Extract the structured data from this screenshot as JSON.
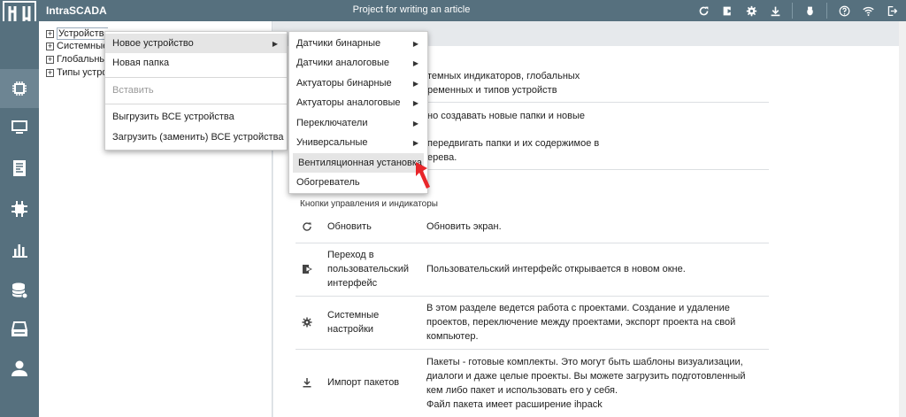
{
  "app": {
    "name": "IntraSCADA",
    "project": "Project for writing an article"
  },
  "topbar": {
    "icons": [
      "refresh-icon",
      "open-ui-icon",
      "gear-icon",
      "download-icon",
      "bug-icon",
      "help-icon",
      "wifi-icon",
      "logout-icon"
    ]
  },
  "sidebar": {
    "items": [
      "devices-icon",
      "monitor-icon",
      "document-icon",
      "network-icon",
      "chart-icon",
      "database-icon",
      "printer-icon",
      "user-icon"
    ]
  },
  "tree": {
    "items": [
      {
        "label": "Устройства"
      },
      {
        "label": "Системные"
      },
      {
        "label": "Глобальны"
      },
      {
        "label": "Типы устро"
      }
    ]
  },
  "context_menu": {
    "items": [
      {
        "label": "Новое устройство"
      },
      {
        "label": "Новая папка"
      },
      {
        "label": "Вставить"
      },
      {
        "label": "Выгрузить ВСЕ устройства"
      },
      {
        "label": "Загрузить (заменить) ВСЕ устройства"
      }
    ]
  },
  "submenu": {
    "items": [
      {
        "label": "Датчики бинарные"
      },
      {
        "label": "Датчики аналоговые"
      },
      {
        "label": "Актуаторы бинарные"
      },
      {
        "label": "Актуаторы аналоговые"
      },
      {
        "label": "Переключатели"
      },
      {
        "label": "Универсальные"
      },
      {
        "label": "Вентиляционная установка"
      },
      {
        "label": "Обогреватель"
      }
    ]
  },
  "help": {
    "intro_1": "темных индикаторов, глобальных",
    "intro_2": "ременных и типов устройств",
    "para2_1": "но создавать новые папки и новые",
    "para2_2": "передвигать папки и их содержимое в",
    "para2_3": "ерева.",
    "section_title": "Кнопки управления и индикаторы",
    "rows": [
      {
        "icon": "refresh-icon",
        "name": "Обновить",
        "desc": "Обновить экран."
      },
      {
        "icon": "open-ui-icon",
        "name_1": "Переход в",
        "name_2": "пользовательский",
        "name_3": "интерфейс",
        "desc": "Пользовательский интерфейс открывается в новом окне."
      },
      {
        "icon": "gear-icon",
        "name_1": "Системные",
        "name_2": "настройки",
        "desc_1": "В этом разделе ведется работа с проектами. Создание и удаление",
        "desc_2": "проектов, переключение между проектами, экспорт проекта на свой",
        "desc_3": "компьютер."
      },
      {
        "icon": "download-icon",
        "name": "Импорт пакетов",
        "desc_1": "Пакеты - готовые комплекты. Это могут быть шаблоны визуализации,",
        "desc_2": "диалоги и даже целые проекты. Вы можете загрузить подготовленный",
        "desc_3": "кем либо пакет и использовать его у себя.",
        "desc_4": "Файл пакета имеет расширение ihpack"
      }
    ]
  },
  "colors": {
    "bar": "#56707e",
    "sidebar_active": "#6d8593",
    "pointer": "#e8262a"
  }
}
